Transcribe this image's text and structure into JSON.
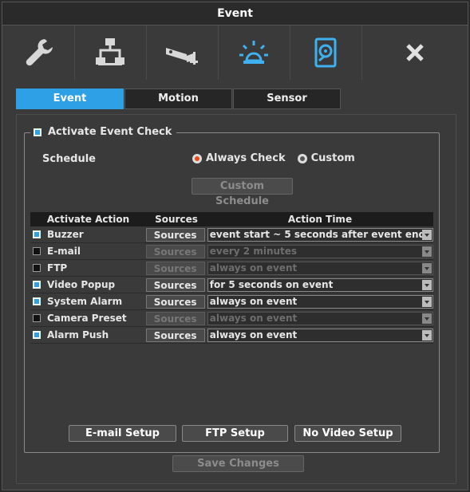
{
  "window": {
    "title": "Event"
  },
  "toolbar": [
    {
      "name": "wrench-icon",
      "active": false
    },
    {
      "name": "network-icon",
      "active": false
    },
    {
      "name": "camera-icon",
      "active": false
    },
    {
      "name": "alarm-light-icon",
      "active": true
    },
    {
      "name": "storage-icon",
      "active": true
    },
    {
      "name": "close-icon",
      "active": false
    }
  ],
  "tabs": [
    {
      "label": "Event",
      "active": true
    },
    {
      "label": "Motion",
      "active": false
    },
    {
      "label": "Sensor",
      "active": false
    }
  ],
  "activate": {
    "label": "Activate Event Check",
    "checked": true
  },
  "schedule": {
    "label": "Schedule",
    "options": [
      {
        "label": "Always Check",
        "selected": true
      },
      {
        "label": "Custom",
        "selected": false
      }
    ],
    "custom_button": "Custom Schedule"
  },
  "table": {
    "headers": {
      "action": "Activate Action",
      "sources": "Sources",
      "time": "Action Time"
    },
    "rows": [
      {
        "name": "Buzzer",
        "checked": true,
        "sources": "Sources",
        "time": "event start ~ 5 seconds after event end",
        "enabled": true
      },
      {
        "name": "E-mail",
        "checked": false,
        "sources": "Sources",
        "time": "every 2 minutes",
        "enabled": false
      },
      {
        "name": "FTP",
        "checked": false,
        "sources": "Sources",
        "time": "always on event",
        "enabled": false
      },
      {
        "name": "Video Popup",
        "checked": true,
        "sources": "Sources",
        "time": "for 5 seconds on event",
        "enabled": true
      },
      {
        "name": "System Alarm",
        "checked": true,
        "sources": "Sources",
        "time": "always on event",
        "enabled": true
      },
      {
        "name": "Camera Preset",
        "checked": false,
        "sources": "Sources",
        "time": "always on event",
        "enabled": false
      },
      {
        "name": "Alarm Push",
        "checked": true,
        "sources": "Sources",
        "time": "always on event",
        "enabled": true
      }
    ]
  },
  "setup_buttons": {
    "email": "E-mail Setup",
    "ftp": "FTP Setup",
    "novideo": "No Video Setup"
  },
  "save_button": "Save Changes",
  "colors": {
    "accent": "#2da0e6",
    "radio_selected": "#e84a1a"
  }
}
